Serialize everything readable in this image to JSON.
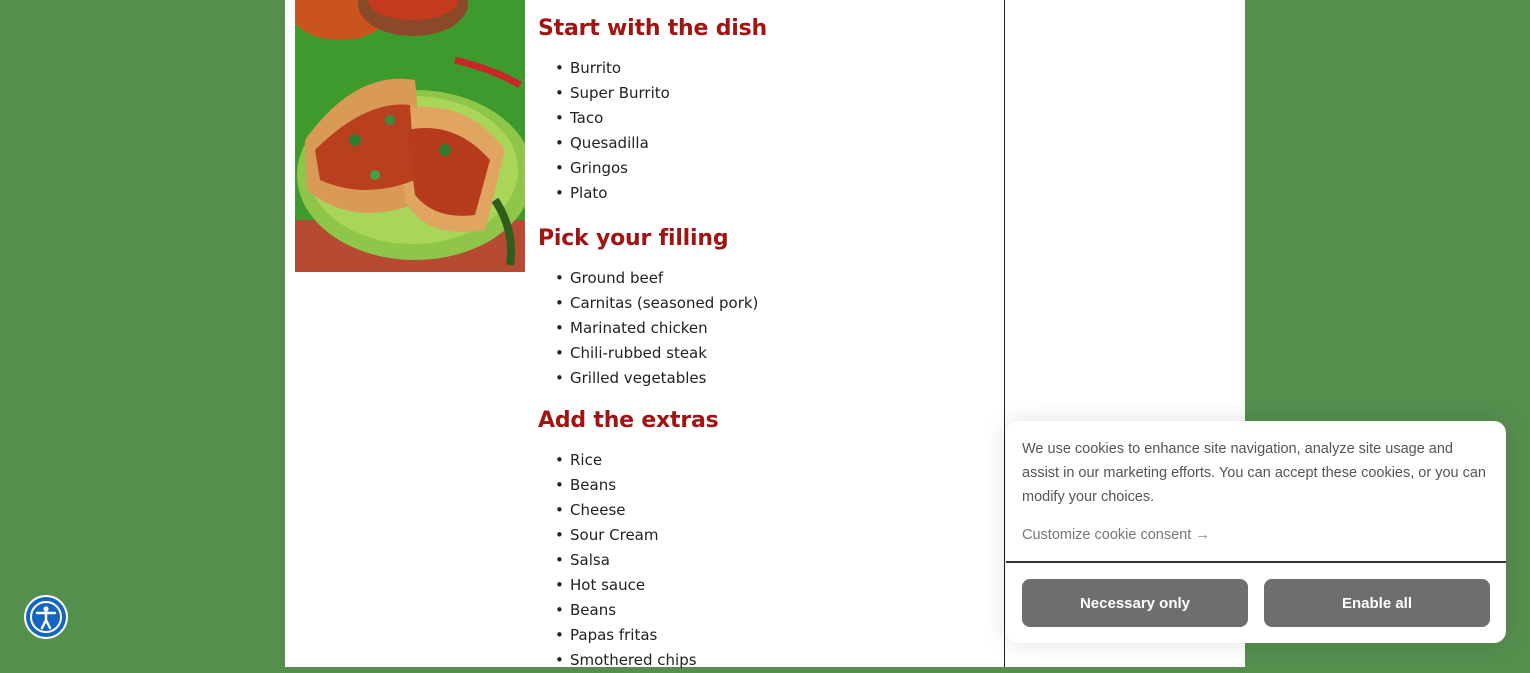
{
  "colors": {
    "background": "#558f4e",
    "heading": "#a01414",
    "button": "#6e6e6e",
    "accessibility": "#1565c0"
  },
  "sections": [
    {
      "heading": "Start with the dish",
      "items": [
        "Burrito",
        "Super Burrito",
        "Taco",
        "Quesadilla",
        "Gringos",
        "Plato"
      ]
    },
    {
      "heading": "Pick your filling",
      "items": [
        "Ground beef",
        "Carnitas (seasoned pork)",
        "Marinated chicken",
        "Chili-rubbed steak",
        "Grilled vegetables"
      ]
    },
    {
      "heading": "Add the extras",
      "items": [
        "Rice",
        "Beans",
        "Cheese",
        "Sour Cream",
        "Salsa",
        "Hot sauce",
        "Beans",
        "Papas fritas",
        "Smothered chips"
      ]
    }
  ],
  "cookie_banner": {
    "message": "We use cookies to enhance site navigation, analyze site usage and assist in our marketing efforts. You can accept these cookies, or you can modify your choices.",
    "customize_label": "Customize cookie consent",
    "customize_arrow": "→",
    "necessary_label": "Necessary only",
    "enable_label": "Enable all"
  },
  "accessibility_button": {
    "icon": "accessibility-person-icon"
  }
}
